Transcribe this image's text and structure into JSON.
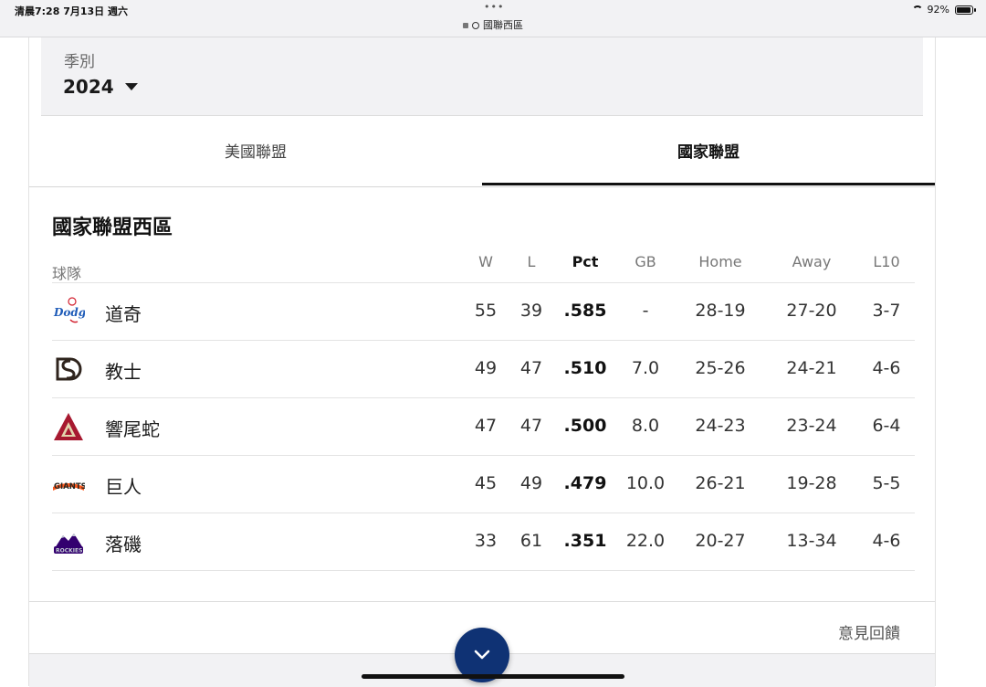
{
  "status_bar": {
    "time_date": "清晨7:28   7月13日 週六",
    "url": "國聯西區",
    "battery": "92%",
    "battery_level": 0.92
  },
  "season": {
    "label": "季別",
    "value": "2024"
  },
  "tabs": [
    {
      "label": "美國聯盟",
      "active": false
    },
    {
      "label": "國家聯盟",
      "active": true
    }
  ],
  "division": {
    "title": "國家聯盟西區"
  },
  "table": {
    "team_header": "球隊",
    "columns": [
      "W",
      "L",
      "Pct",
      "GB",
      "Home",
      "Away",
      "L10"
    ],
    "rows": [
      {
        "team": "道奇",
        "logo": "dodgers-logo",
        "w": "55",
        "l": "39",
        "pct": ".585",
        "gb": "-",
        "home": "28-19",
        "away": "27-20",
        "l10": "3-7"
      },
      {
        "team": "教士",
        "logo": "padres-logo",
        "w": "49",
        "l": "47",
        "pct": ".510",
        "gb": "7.0",
        "home": "25-26",
        "away": "24-21",
        "l10": "4-6"
      },
      {
        "team": "響尾蛇",
        "logo": "diamondbacks-logo",
        "w": "47",
        "l": "47",
        "pct": ".500",
        "gb": "8.0",
        "home": "24-23",
        "away": "23-24",
        "l10": "6-4"
      },
      {
        "team": "巨人",
        "logo": "giants-logo",
        "w": "45",
        "l": "49",
        "pct": ".479",
        "gb": "10.0",
        "home": "26-21",
        "away": "19-28",
        "l10": "5-5"
      },
      {
        "team": "落磯",
        "logo": "rockies-logo",
        "w": "33",
        "l": "61",
        "pct": ".351",
        "gb": "22.0",
        "home": "20-27",
        "away": "13-34",
        "l10": "4-6"
      }
    ]
  },
  "feedback": "意見回饋",
  "fab_icon": "chevron-down-icon",
  "colors": {
    "accent": "#0f3274",
    "dodgers": "#1e5bb8",
    "padres": "#2f241d",
    "diamondbacks": "#a71930",
    "giants": "#fd5a1e",
    "rockies": "#33006f"
  }
}
